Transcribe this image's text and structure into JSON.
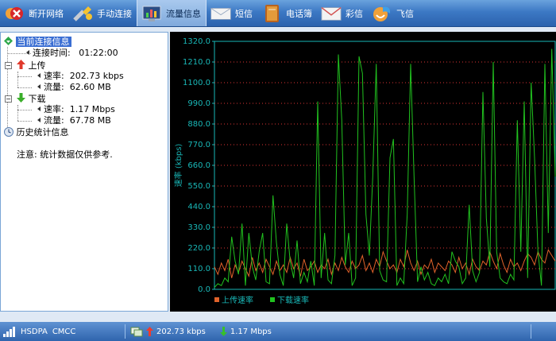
{
  "toolbar": {
    "items": [
      {
        "label": "断开网络",
        "icon": "disconnect-icon"
      },
      {
        "label": "手动连接",
        "icon": "manual-connect-icon"
      },
      {
        "label": "流量信息",
        "icon": "traffic-info-icon",
        "active": true
      },
      {
        "label": "短信",
        "icon": "sms-icon"
      },
      {
        "label": "电话簿",
        "icon": "phonebook-icon"
      },
      {
        "label": "彩信",
        "icon": "mms-icon"
      },
      {
        "label": "飞信",
        "icon": "fetion-icon"
      }
    ]
  },
  "tree": {
    "current": "当前连接信息",
    "conn_time_label": "连接时间:",
    "conn_time": "01:22:00",
    "upload": "上传",
    "download": "下载",
    "rate_label": "速率:",
    "traffic_label": "流量:",
    "up_rate": "202.73 kbps",
    "up_traffic": "62.60 MB",
    "down_rate": "1.17 Mbps",
    "down_traffic": "67.78 MB",
    "history": "历史统计信息",
    "note": "注意: 统计数据仅供参考."
  },
  "chart_data": {
    "type": "line",
    "ylabel": "速率 (kbps)",
    "ylim": [
      0,
      1320
    ],
    "yticks": [
      "0.0",
      "110.0",
      "220.0",
      "330.0",
      "440.0",
      "550.0",
      "660.0",
      "770.0",
      "880.0",
      "990.0",
      "1100.0",
      "1210.0",
      "1320.0"
    ],
    "grid": true,
    "legend_position": "bottom-left",
    "series": [
      {
        "name": "上传速率",
        "color": "#e0622a",
        "values": [
          120,
          80,
          140,
          100,
          160,
          60,
          130,
          90,
          150,
          110,
          70,
          170,
          100,
          140,
          90,
          160,
          120,
          80,
          150,
          100,
          130,
          90,
          170,
          110,
          140,
          70,
          160,
          100,
          120,
          150,
          90,
          130,
          110,
          160,
          80,
          140,
          100,
          170,
          120,
          90,
          150,
          110,
          130,
          180,
          100,
          140,
          90,
          160,
          120,
          200,
          150,
          110,
          130,
          90,
          160,
          120,
          210,
          140,
          100,
          150,
          80,
          130,
          110,
          160,
          90,
          140,
          120,
          100,
          150,
          130,
          90,
          170,
          110,
          140,
          80,
          160,
          120,
          100,
          150,
          130,
          200,
          150,
          110,
          190,
          130,
          90,
          160,
          120,
          140,
          100,
          150,
          190,
          170,
          130,
          200,
          160,
          140,
          210,
          180,
          150
        ]
      },
      {
        "name": "下载速率",
        "color": "#21c21f",
        "values": [
          10,
          30,
          20,
          60,
          40,
          280,
          150,
          80,
          350,
          20,
          300,
          120,
          50,
          200,
          300,
          40,
          30,
          500,
          250,
          80,
          20,
          350,
          150,
          60,
          260,
          30,
          90,
          40,
          150,
          20,
          1000,
          60,
          300,
          50,
          30,
          180,
          1250,
          900,
          130,
          300,
          20,
          60,
          1240,
          1150,
          400,
          180,
          600,
          1200,
          100,
          50,
          40,
          700,
          800,
          20,
          60,
          30,
          400,
          1200,
          600,
          40,
          120,
          50,
          90,
          30,
          20,
          60,
          40,
          80,
          30,
          200,
          150,
          120,
          30,
          60,
          450,
          100,
          40,
          90,
          1050,
          380,
          120,
          1210,
          200,
          60,
          40,
          30,
          80,
          50,
          900,
          200,
          1000,
          60,
          1100,
          700,
          200,
          20,
          1200,
          300,
          1280,
          600
        ]
      }
    ]
  },
  "status": {
    "network": "HSDPA",
    "operator": "CMCC",
    "up_rate": "202.73 kbps",
    "down_rate": "1.17 Mbps"
  }
}
